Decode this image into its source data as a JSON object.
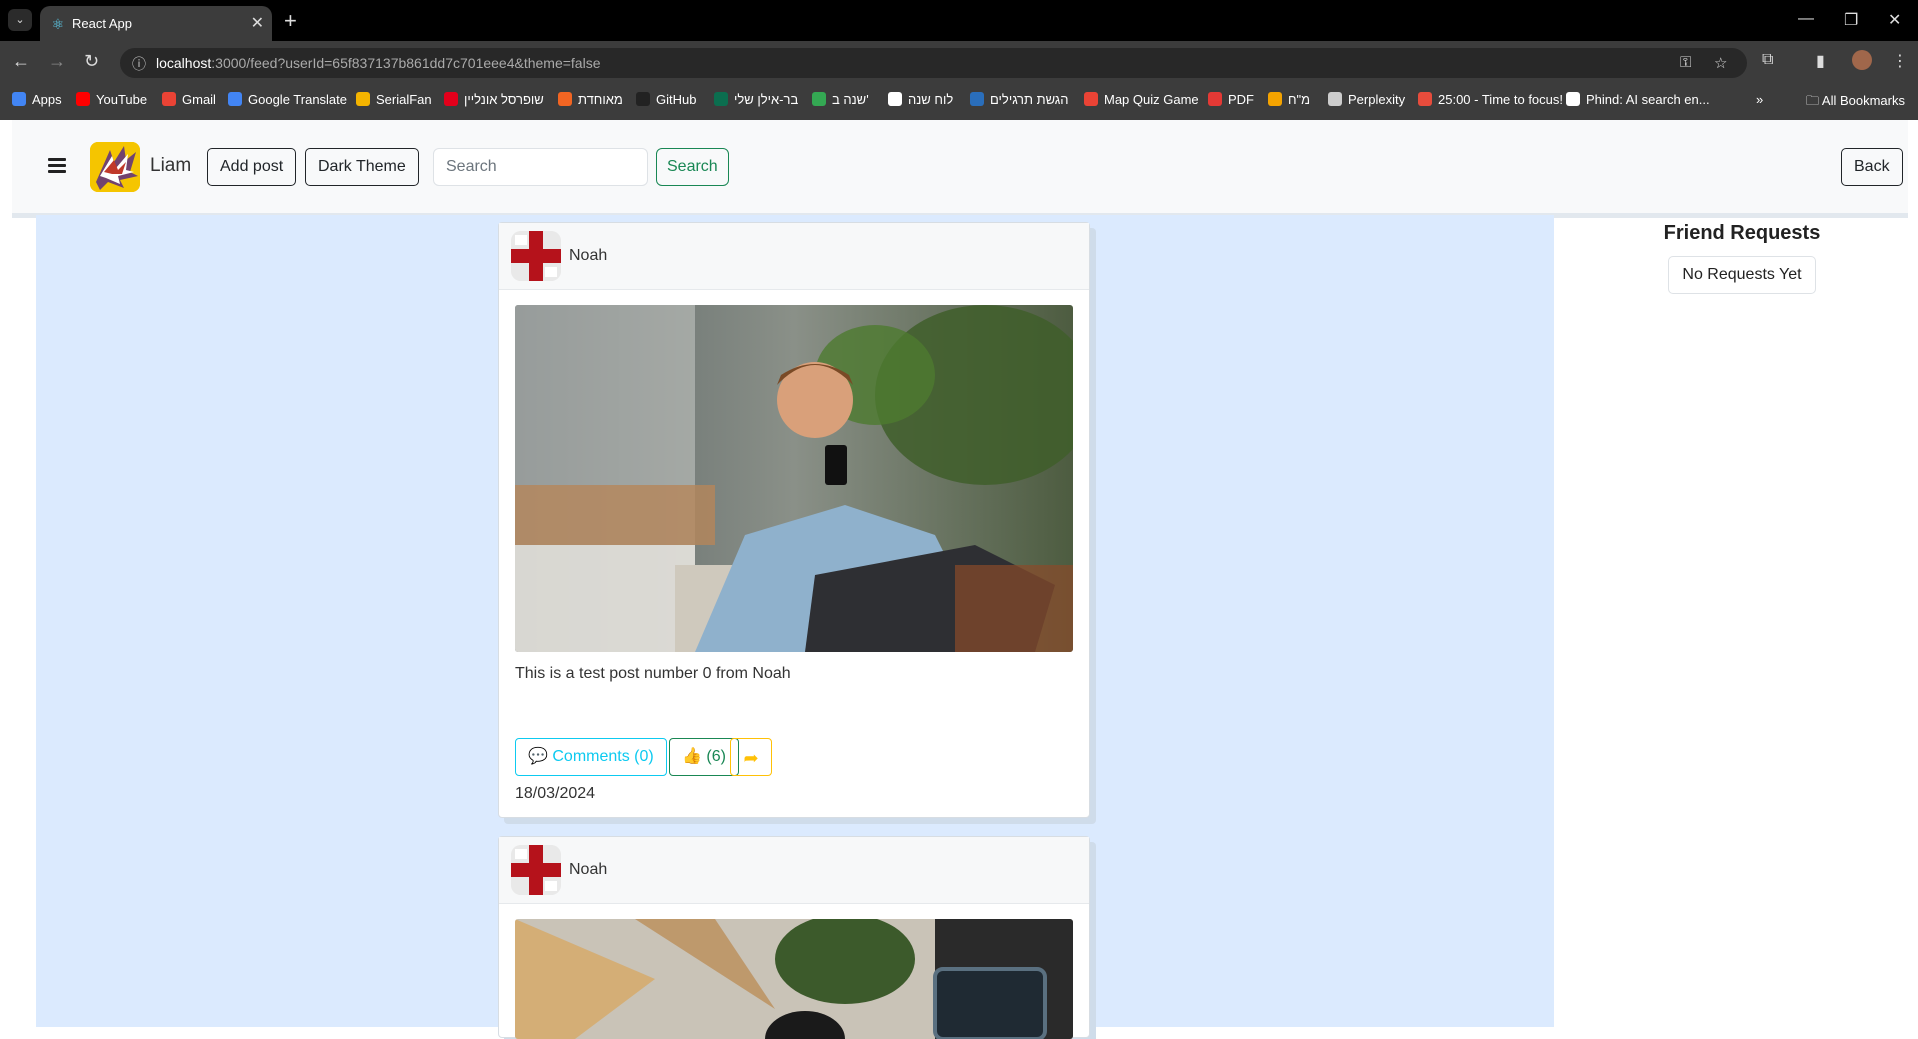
{
  "browser": {
    "tab_title": "React App",
    "url_host": "localhost",
    "url_rest": ":3000/feed?userId=65f837137b861dd7c701eee4&theme=false",
    "bookmarks": [
      {
        "label": "Apps",
        "color": "#4285f4"
      },
      {
        "label": "YouTube",
        "color": "#ff0000"
      },
      {
        "label": "Gmail",
        "color": "#ea4335"
      },
      {
        "label": "Google Translate",
        "color": "#4285f4"
      },
      {
        "label": "SerialFan",
        "color": "#f4b400"
      },
      {
        "label": "שופרסל אונליין",
        "color": "#e3001b"
      },
      {
        "label": "מאוחדת",
        "color": "#f26522"
      },
      {
        "label": "GitHub",
        "color": "#222222"
      },
      {
        "label": "בר-אילן שלי",
        "color": "#0b6e4f"
      },
      {
        "label": "שנה ב'",
        "color": "#34a853"
      },
      {
        "label": "לוח שנה",
        "color": "#ffffff"
      },
      {
        "label": "הגשת תרגילים",
        "color": "#2a6ebb"
      },
      {
        "label": "Map Quiz Game",
        "color": "#ea4335"
      },
      {
        "label": "PDF",
        "color": "#e53935"
      },
      {
        "label": "מ\"ח",
        "color": "#f4a300"
      },
      {
        "label": "Perplexity",
        "color": "#cccccc"
      },
      {
        "label": "25:00 - Time to focus!",
        "color": "#e74c3c"
      },
      {
        "label": "Phind: AI search en...",
        "color": "#ffffff"
      }
    ],
    "all_bookmarks": "All Bookmarks"
  },
  "navbar": {
    "brand_name": "Liam",
    "add_post_label": "Add post",
    "theme_label": "Dark Theme",
    "search_placeholder": "Search",
    "search_button": "Search",
    "back_label": "Back"
  },
  "posts": [
    {
      "author": "Noah",
      "text": "This is a test post number 0 from Noah",
      "comments_label": "Comments (0)",
      "likes_label": "(6)",
      "date": "18/03/2024"
    },
    {
      "author": "Noah"
    }
  ],
  "friend_requests": {
    "title": "Friend Requests",
    "empty_label": "No Requests Yet"
  },
  "colors": {
    "feed_bg": "#dbeafe",
    "comments": "#0dcaf0",
    "likes": "#198754",
    "share": "#ffc107"
  }
}
